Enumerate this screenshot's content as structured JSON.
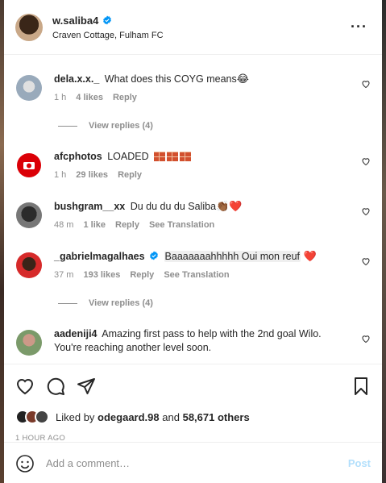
{
  "post": {
    "username": "w.saliba4",
    "location": "Craven Cottage, Fulham FC",
    "more_icon": "more-horizontal-icon"
  },
  "comments": [
    {
      "user": "dela.x.x._",
      "text": "What does this COYG means",
      "emoji": "😂",
      "time": "1 h",
      "likes": "4 likes",
      "reply": "Reply",
      "view_replies": "View replies (4)"
    },
    {
      "user": "afcphotos",
      "text": "LOADED",
      "time": "1 h",
      "likes": "29 likes",
      "reply": "Reply"
    },
    {
      "user": "bushgram__xx",
      "text": "Du du du du Saliba",
      "emoji": "👏🏾❤️",
      "time": "48 m",
      "likes": "1 like",
      "reply": "Reply",
      "translate": "See Translation"
    },
    {
      "user": "_gabrielmagalhaes",
      "text": "Baaaaaaahhhhh Oui mon reuf",
      "emoji": "❤️",
      "time": "37 m",
      "likes": "193 likes",
      "reply": "Reply",
      "translate": "See Translation",
      "view_replies": "View replies (4)"
    },
    {
      "user": "aadeniji4",
      "text": "Amazing first pass to help with the 2nd goal Wilo. You're reaching another level soon."
    }
  ],
  "actions": {
    "liked_prefix": "Liked by",
    "liked_user": "odegaard.98",
    "liked_and": "and",
    "liked_others": "58,671 others",
    "time_ago": "1 HOUR AGO"
  },
  "add_comment": {
    "placeholder": "Add a comment…",
    "post_label": "Post"
  },
  "colors": {
    "verified": "#0095f6",
    "heart_emoji": "#e0245e",
    "post_disabled": "#b2dffc",
    "muted_text": "#8e8e8e"
  }
}
